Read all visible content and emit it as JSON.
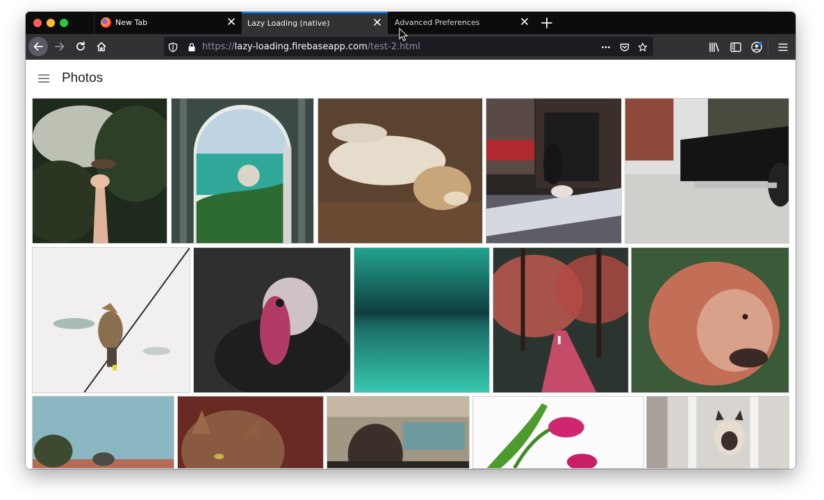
{
  "browser": {
    "tabs": [
      {
        "label": "New Tab",
        "active": false
      },
      {
        "label": "Lazy Loading (native)",
        "active": true
      },
      {
        "label": "Advanced Preferences",
        "active": false
      }
    ],
    "url": {
      "scheme": "https://",
      "host": "lazy-loading.firebaseapp.com",
      "path": "/test-2.html"
    },
    "accent_color": "#0a84ff"
  },
  "page": {
    "title": "Photos",
    "photos": [
      {
        "subject": "hand holding bird in garden"
      },
      {
        "subject": "coastline through archway"
      },
      {
        "subject": "lion lying on ground"
      },
      {
        "subject": "person walking dog on street"
      },
      {
        "subject": "vintage car on street"
      },
      {
        "subject": "waxwing bird on wire"
      },
      {
        "subject": "turkey portrait"
      },
      {
        "subject": "underwater turquoise"
      },
      {
        "subject": "path through red forest"
      },
      {
        "subject": "lion portrait"
      },
      {
        "subject": "landscape with tree"
      },
      {
        "subject": "cat close-up"
      },
      {
        "subject": "person in car"
      },
      {
        "subject": "pink tulips"
      },
      {
        "subject": "siamese cat at window"
      }
    ]
  }
}
